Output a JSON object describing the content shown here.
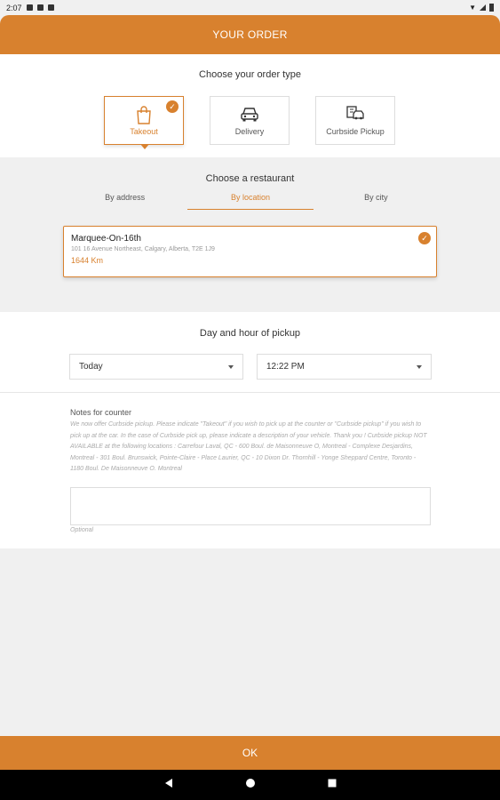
{
  "status_bar": {
    "time": "2:07"
  },
  "header": {
    "title": "YOUR ORDER"
  },
  "order_type": {
    "title": "Choose your order type",
    "options": [
      {
        "label": "Takeout",
        "icon": "bag-icon",
        "selected": true
      },
      {
        "label": "Delivery",
        "icon": "car-icon",
        "selected": false
      },
      {
        "label": "Curbside Pickup",
        "icon": "curbside-icon",
        "selected": false
      }
    ]
  },
  "restaurant": {
    "title": "Choose a restaurant",
    "tabs": [
      {
        "label": "By address",
        "active": false
      },
      {
        "label": "By location",
        "active": true
      },
      {
        "label": "By city",
        "active": false
      }
    ],
    "selected": {
      "name": "Marquee-On-16th",
      "address": "101 16 Avenue Northeast, Calgary, Alberta, T2E 1J9",
      "distance": "1644 Km"
    }
  },
  "pickup": {
    "title": "Day and hour of pickup",
    "day": "Today",
    "time": "12:22 PM"
  },
  "notes": {
    "label": "Notes for counter",
    "help": "We now offer Curbside pickup. Please indicate \"Takeout\" if you wish to pick up at the counter or \"Curbside pickup\" if you wish to pick up at the car. In the case of Curbside pick up, please indicate a description of your vehicle. Thank you ! Curbside pickup NOT AVAILABLE at the following locations : Carrefour Laval, QC - 600 Boul. de Maisonneuve O, Montreal - Complexe Desjardins, Montreal - 301 Boul. Brunswick, Pointe-Claire - Place Laurier, QC - 10 Dixon Dr. Thornhill - Yonge Sheppard Centre, Toronto - 1180 Boul. De Maisonneuve O. Montreal",
    "value": "",
    "optional": "Optional"
  },
  "footer": {
    "ok_label": "OK"
  },
  "colors": {
    "accent": "#d8812e"
  }
}
